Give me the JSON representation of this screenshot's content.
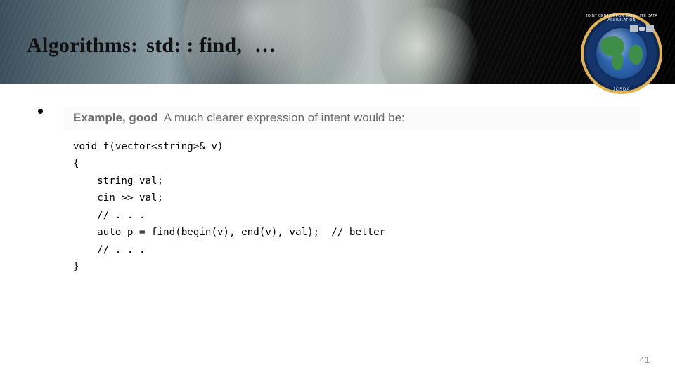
{
  "header": {
    "title_lead": "Algorithms:",
    "title_mid": "std: : find,",
    "title_tail": "…"
  },
  "logo": {
    "top_text": "JOINT CENTER FOR SATELLITE DATA ASSIMILATION",
    "bottom_text": "JCSDA"
  },
  "example": {
    "label": "Example, good",
    "caption": "A much clearer expression of intent would be:",
    "code": "void f(vector<string>& v)\n{\n    string val;\n    cin >> val;\n    // . . .\n    auto p = find(begin(v), end(v), val);  // better\n    // . . .\n}"
  },
  "page_number": "41"
}
